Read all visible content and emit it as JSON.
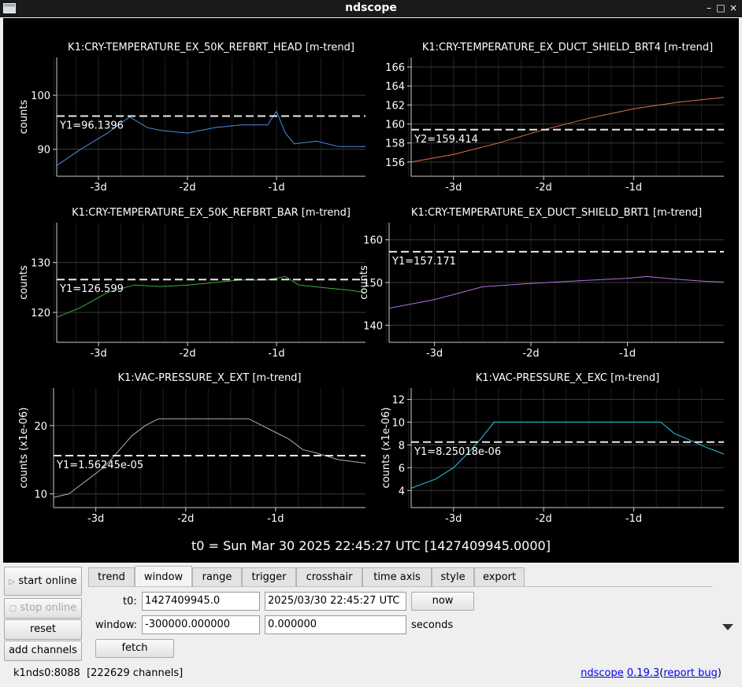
{
  "window": {
    "title": "ndscope"
  },
  "t0_label": "t0 = Sun Mar 30 2025 22:45:27 UTC [1427409945.0000]",
  "plots": [
    {
      "title": "K1:CRY-TEMPERATURE_EX_50K_REFBRT_HEAD [m-trend]",
      "ylabel": "counts",
      "yticks": [
        "90",
        "100"
      ],
      "xticks": [
        "-3d",
        "-2d",
        "-1d"
      ],
      "cursor_label": "Y1=96.1396",
      "color": "#4a8fe0",
      "series": [
        [
          -3.47,
          87
        ],
        [
          -3.2,
          90
        ],
        [
          -2.9,
          93
        ],
        [
          -2.65,
          96
        ],
        [
          -2.45,
          94
        ],
        [
          -2.3,
          93.5
        ],
        [
          -2.0,
          93
        ],
        [
          -1.7,
          94
        ],
        [
          -1.4,
          94.5
        ],
        [
          -1.1,
          94.5
        ],
        [
          -1.0,
          97
        ],
        [
          -0.9,
          93
        ],
        [
          -0.8,
          91
        ],
        [
          -0.55,
          91.5
        ],
        [
          -0.3,
          90.5
        ],
        [
          -0.0,
          90.5
        ]
      ]
    },
    {
      "title": "K1:CRY-TEMPERATURE_EX_DUCT_SHIELD_BRT4 [m-trend]",
      "ylabel": "",
      "yticks": [
        "156",
        "158",
        "160",
        "162",
        "164",
        "166"
      ],
      "xticks": [
        "-3d",
        "-2d",
        "-1d"
      ],
      "cursor_label": "Y2=159.414",
      "color": "#e07050",
      "series": [
        [
          -3.47,
          156
        ],
        [
          -3.0,
          156.8
        ],
        [
          -2.5,
          158
        ],
        [
          -2.0,
          159.4
        ],
        [
          -1.5,
          160.6
        ],
        [
          -1.0,
          161.6
        ],
        [
          -0.5,
          162.3
        ],
        [
          -0.0,
          162.8
        ]
      ]
    },
    {
      "title": "K1:CRY-TEMPERATURE_EX_50K_REFBRT_BAR [m-trend]",
      "ylabel": "counts",
      "yticks": [
        "120",
        "130"
      ],
      "xticks": [
        "-3d",
        "-2d",
        "-1d"
      ],
      "cursor_label": "Y1=126.599",
      "color": "#3fae3a",
      "series": [
        [
          -3.47,
          119
        ],
        [
          -3.2,
          121
        ],
        [
          -2.9,
          124
        ],
        [
          -2.6,
          125.5
        ],
        [
          -2.3,
          125.2
        ],
        [
          -2.0,
          125.5
        ],
        [
          -1.7,
          126
        ],
        [
          -1.4,
          126.5
        ],
        [
          -1.1,
          126.5
        ],
        [
          -0.9,
          127.2
        ],
        [
          -0.75,
          125.5
        ],
        [
          -0.5,
          125
        ],
        [
          -0.2,
          124.5
        ],
        [
          -0.0,
          124
        ]
      ]
    },
    {
      "title": "K1:CRY-TEMPERATURE_EX_DUCT_SHIELD_BRT1 [m-trend]",
      "ylabel": "counts",
      "yticks": [
        "140",
        "150",
        "160"
      ],
      "xticks": [
        "-3d",
        "-2d",
        "-1d"
      ],
      "cursor_label": "Y1=157.171",
      "color": "#b070e0",
      "series": [
        [
          -3.47,
          144
        ],
        [
          -3.0,
          146
        ],
        [
          -2.5,
          149
        ],
        [
          -2.0,
          149.8
        ],
        [
          -1.5,
          150.4
        ],
        [
          -1.0,
          151
        ],
        [
          -0.8,
          151.4
        ],
        [
          -0.5,
          150.8
        ],
        [
          -0.2,
          150.3
        ],
        [
          -0.0,
          150.1
        ]
      ]
    },
    {
      "title": "K1:VAC-PRESSURE_X_EXT [m-trend]",
      "ylabel": "counts (x1e-06)",
      "yticks": [
        "10",
        "20"
      ],
      "xticks": [
        "-3d",
        "-2d",
        "-1d"
      ],
      "cursor_label": "Y1=1.56245e-05",
      "color": "#b0b0b0",
      "series": [
        [
          -3.47,
          9.5
        ],
        [
          -3.3,
          10
        ],
        [
          -3.2,
          11
        ],
        [
          -3.1,
          12
        ],
        [
          -3.0,
          13
        ],
        [
          -2.9,
          14
        ],
        [
          -2.8,
          15.5
        ],
        [
          -2.7,
          17
        ],
        [
          -2.6,
          18.5
        ],
        [
          -2.45,
          20
        ],
        [
          -2.3,
          21
        ],
        [
          -1.5,
          21
        ],
        [
          -1.3,
          21
        ],
        [
          -1.15,
          20
        ],
        [
          -1.0,
          19
        ],
        [
          -0.85,
          18
        ],
        [
          -0.7,
          16.5
        ],
        [
          -0.55,
          16
        ],
        [
          -0.3,
          15
        ],
        [
          -0.0,
          14.5
        ]
      ]
    },
    {
      "title": "K1:VAC-PRESSURE_X_EXC [m-trend]",
      "ylabel": "counts (x1e-06)",
      "yticks": [
        "4",
        "6",
        "8",
        "10",
        "12"
      ],
      "xticks": [
        "-3d",
        "-2d",
        "-1d"
      ],
      "cursor_label": "Y1=8.25018e-06",
      "color": "#28c8e0",
      "series": [
        [
          -3.47,
          4.2
        ],
        [
          -3.2,
          5
        ],
        [
          -3.0,
          6
        ],
        [
          -2.85,
          7.2
        ],
        [
          -2.7,
          8.5
        ],
        [
          -2.55,
          10
        ],
        [
          -2.0,
          10
        ],
        [
          -1.5,
          10
        ],
        [
          -1.0,
          10
        ],
        [
          -0.7,
          10
        ],
        [
          -0.55,
          9
        ],
        [
          -0.4,
          8.5
        ],
        [
          -0.2,
          7.8
        ],
        [
          -0.0,
          7.2
        ]
      ]
    }
  ],
  "left_buttons": {
    "start_online": "start online",
    "stop_online": "stop online",
    "reset": "reset",
    "add_channels": "add channels"
  },
  "tabs": [
    "trend",
    "window",
    "range",
    "trigger",
    "crosshair",
    "time axis",
    "style",
    "export"
  ],
  "window_tab": {
    "t0_label": "t0:",
    "t0_gps": "1427409945.0",
    "t0_utc": "2025/03/30 22:45:27 UTC",
    "now_button": "now",
    "window_label": "window:",
    "window_start": "-300000.000000",
    "window_end": "0.000000",
    "units": "seconds",
    "fetch_button": "fetch"
  },
  "status": {
    "server": "k1nds0:8088",
    "channels": "[222629 channels]"
  },
  "about": {
    "app": "ndscope",
    "version": "0.19.3",
    "open": "(",
    "report": "report bug",
    "close": ")"
  }
}
